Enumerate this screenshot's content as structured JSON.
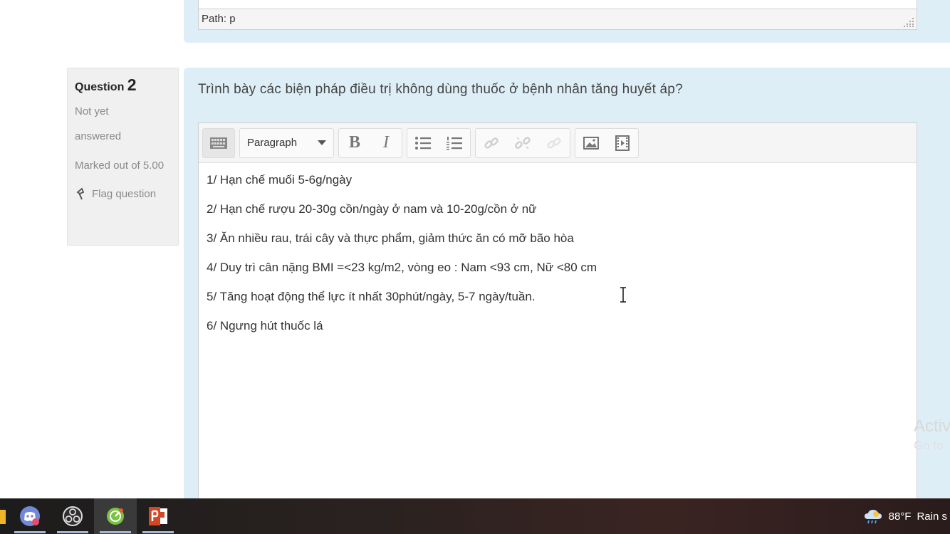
{
  "previous_editor": {
    "path_label": "Path: p"
  },
  "question": {
    "label": "Question",
    "number": "2",
    "state": "Not yet answered",
    "grade": "Marked out of 5.00",
    "flag_label": "Flag question",
    "text": "Trình bày các biện pháp điều trị không dùng thuốc ở bệnh nhân tăng huyết áp?"
  },
  "toolbar": {
    "paragraph_select": "Paragraph",
    "bold_label": "B",
    "italic_label": "I",
    "icons": [
      "keyboard-toggle-icon",
      "bold-icon",
      "italic-icon",
      "bullet-list-icon",
      "numbered-list-icon",
      "link-icon",
      "unlink-icon",
      "anchor-icon",
      "image-icon",
      "media-icon"
    ]
  },
  "answer_lines": [
    "1/ Hạn chế muối 5-6g/ngày",
    "2/ Hạn chế rượu 20-30g cồn/ngày ở nam và 10-20g/cồn ở nữ",
    "3/ Ăn nhiều rau, trái cây và thực phẩm, giảm thức ăn có mỡ bão hòa",
    "4/ Duy trì cân nặng BMI =<23 kg/m2, vòng eo : Nam <93 cm, Nữ <80 cm",
    "5/ Tăng hoạt động thể lực ít nhất 30phút/ngày, 5-7 ngày/tuần.",
    "6/ Ngưng hút thuốc lá"
  ],
  "watermark": {
    "line1": "Activ",
    "line2": "Go to"
  },
  "taskbar": {
    "apps": [
      "file-explorer-icon",
      "discord-icon",
      "obs-icon",
      "app-green-icon",
      "powerpoint-icon"
    ],
    "weather_temp": "88°F",
    "weather_text": "Rain s"
  },
  "colors": {
    "question_bg": "#deeef7",
    "info_bg": "#f0f0f0"
  }
}
